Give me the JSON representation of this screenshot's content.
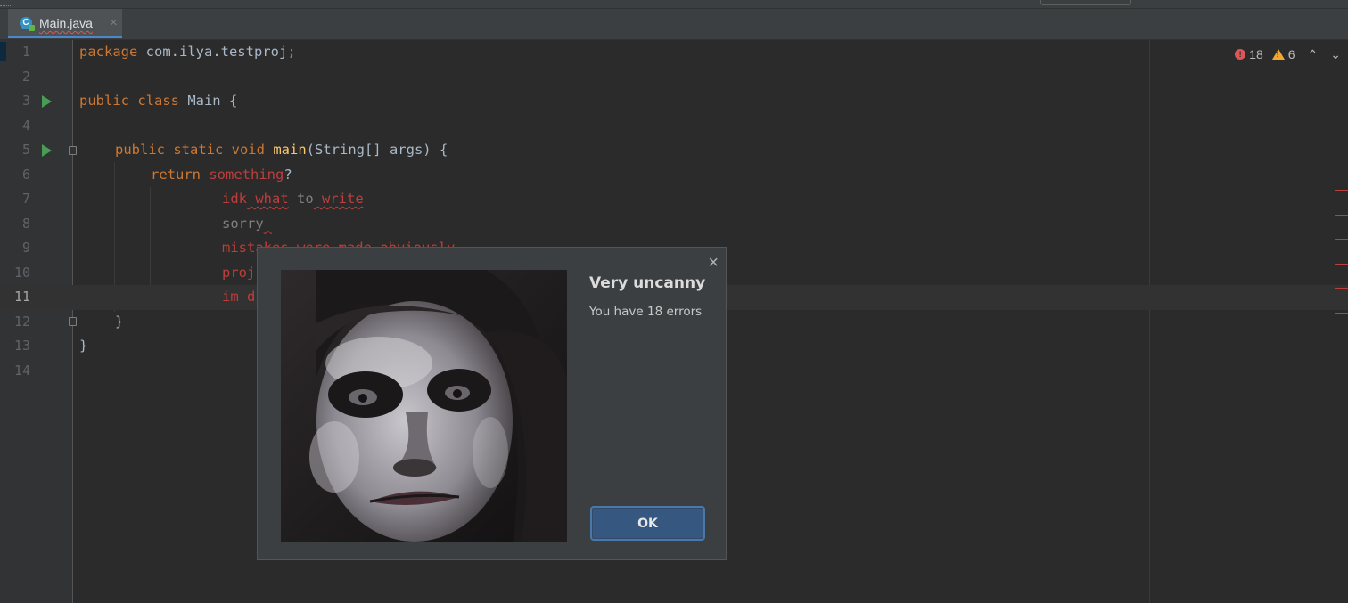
{
  "tab": {
    "icon_letter": "C",
    "filename": "Main.java",
    "close": "×"
  },
  "inspections": {
    "errors": "18",
    "warnings": "6",
    "error_glyph": "!",
    "warning_glyph": "!",
    "up": "⌃",
    "down": "⌄"
  },
  "code_lines": [
    {
      "num": "1"
    },
    {
      "num": "2"
    },
    {
      "num": "3"
    },
    {
      "num": "4"
    },
    {
      "num": "5"
    },
    {
      "num": "6"
    },
    {
      "num": "7"
    },
    {
      "num": "8"
    },
    {
      "num": "9"
    },
    {
      "num": "10"
    },
    {
      "num": "11"
    },
    {
      "num": "12"
    },
    {
      "num": "13"
    },
    {
      "num": "14"
    }
  ],
  "code": {
    "l1": {
      "kw": "package",
      "rest": " com.ilya.testproj",
      "semi": ";"
    },
    "l3": {
      "kw": "public class",
      "rest": " Main {"
    },
    "l5": {
      "kw": "public static void",
      "fn": "main",
      "rest": "(String[] args) {"
    },
    "l6": {
      "kw": "return",
      "err": "something",
      "rest": "?"
    },
    "l7": {
      "w1": "idk",
      "w2": " what",
      "w3": " to",
      "w4": " write"
    },
    "l8": {
      "w1": "sorry",
      "w2": " "
    },
    "l9": {
      "w1": "mistakes were made obviously"
    },
    "l10": {
      "w1": "proj"
    },
    "l11": {
      "w1": "im",
      "w2": " d"
    },
    "l12": {
      "rest": "}"
    },
    "l13": {
      "rest": "}"
    }
  },
  "dialog": {
    "title": "Very uncanny",
    "message": "You have 18 errors",
    "ok_label": "OK",
    "close": "×"
  }
}
